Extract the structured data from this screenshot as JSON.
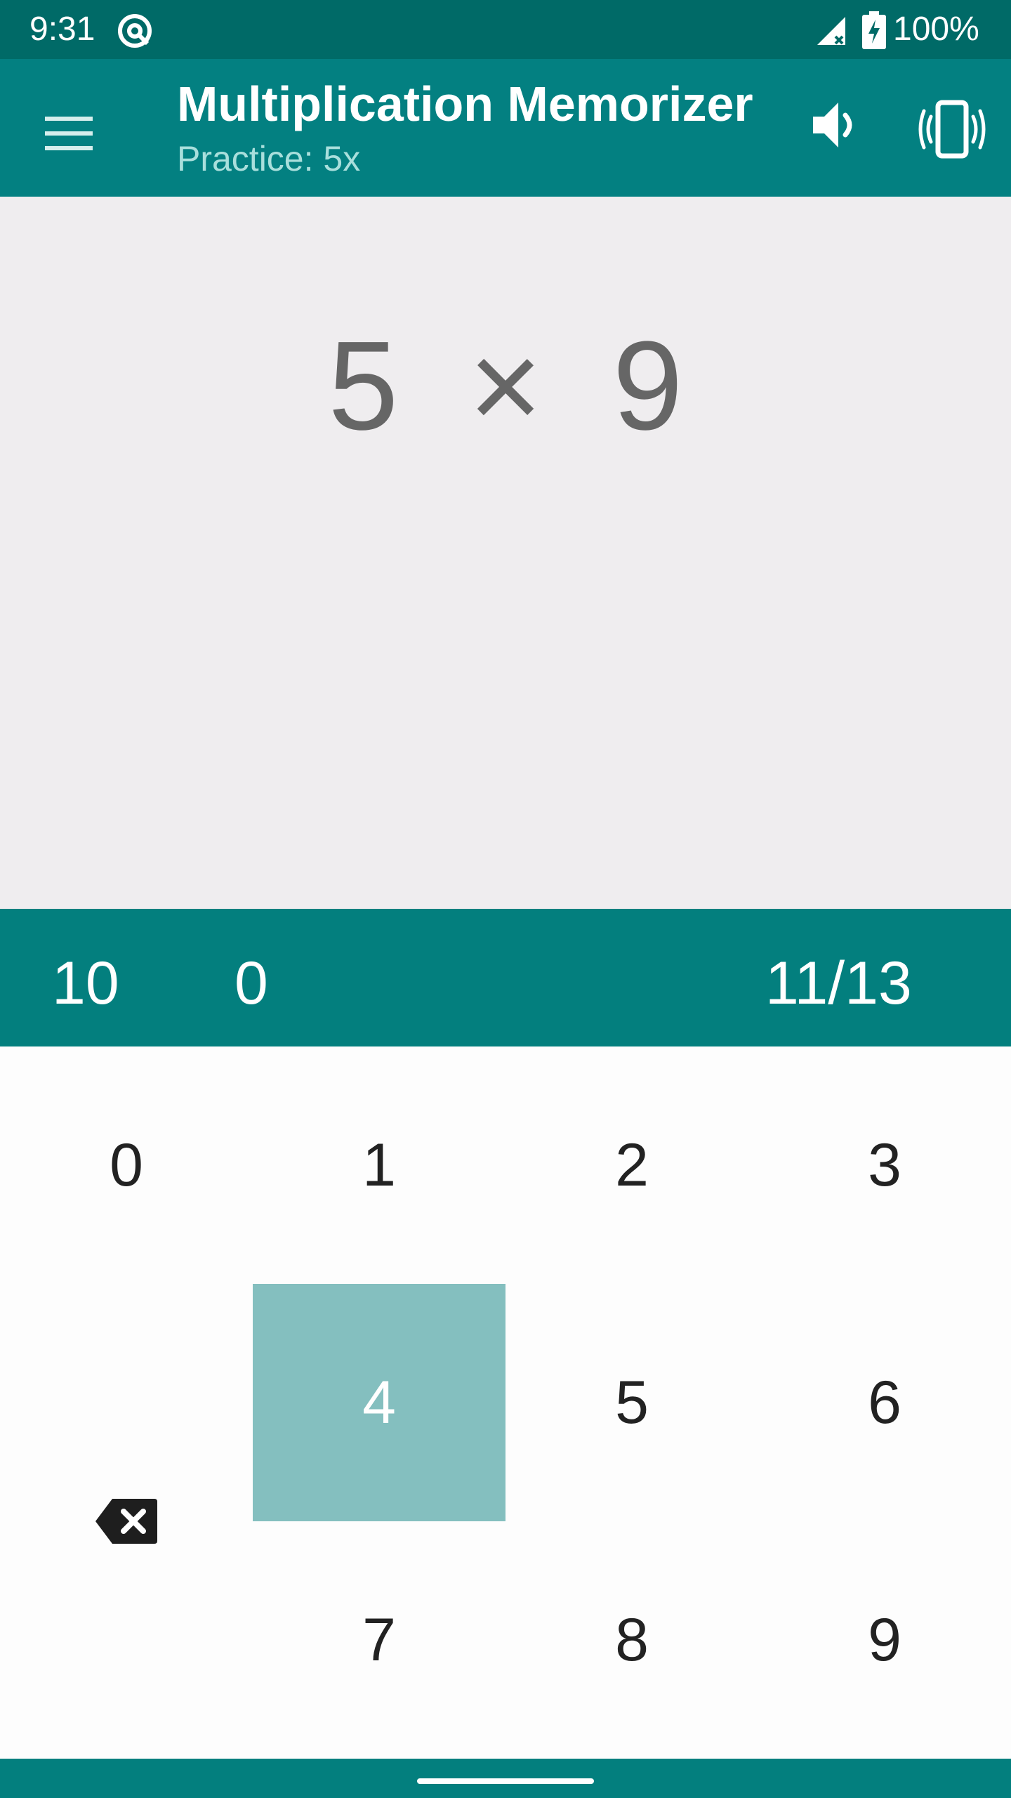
{
  "status_bar": {
    "time": "9:31",
    "battery": "100%",
    "icons": [
      "app-notification-icon",
      "signal-icon",
      "battery-charging-icon"
    ]
  },
  "app_bar": {
    "title": "Multiplication Memorizer",
    "subtitle": "Practice: 5x",
    "icons": [
      "menu-icon",
      "volume-icon",
      "vibrate-icon"
    ]
  },
  "question": {
    "text": "5  ×  9"
  },
  "score_bar": {
    "left": "10",
    "middle": "0",
    "progress": "11/13"
  },
  "keypad": {
    "keys": [
      "0",
      "1",
      "2",
      "3",
      "4",
      "5",
      "6",
      "7",
      "8",
      "9"
    ],
    "pressed_key": "4",
    "backspace_icon": "backspace-icon"
  },
  "colors": {
    "status_bar": "#006a67",
    "app_bar": "#038081",
    "question_bg": "#efedef",
    "score_bar": "#037f7e",
    "pressed_key": "#84bfbf",
    "subtitle": "#a9dfdc"
  }
}
